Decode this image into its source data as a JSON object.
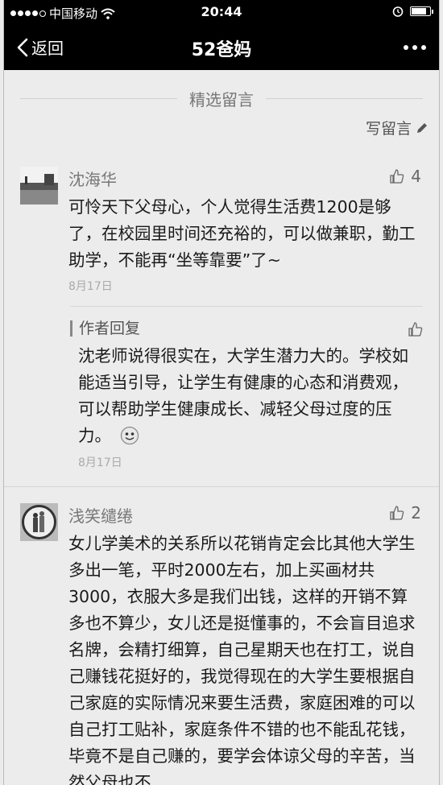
{
  "status_bar": {
    "carrier": "中国移动",
    "time": "20:44",
    "battery_level": 0.85
  },
  "nav": {
    "back_label": "返回",
    "title": "52爸妈"
  },
  "section": {
    "title": "精选留言",
    "write_label": "写留言"
  },
  "comments": [
    {
      "name": "沈海华",
      "likes": "4",
      "text": "可怜天下父母心，个人觉得生活费1200是够了，在校园里时间还充裕的，可以做兼职，勤工助学，不能再“坐等靠要”了~",
      "date": "8月17日",
      "reply": {
        "label": "作者回复",
        "text": "沈老师说得很实在，大学生潜力大的。学校如能适当引导，让学生有健康的心态和消费观，可以帮助学生健康成长、减轻父母过度的压力。",
        "date": "8月17日"
      }
    },
    {
      "name": "浅笑缱绻",
      "likes": "2",
      "text": "女儿学美术的关系所以花销肯定会比其他大学生多出一笔，平时2000左右，加上买画材共3000，衣服大多是我们出钱，这样的开销不算多也不算少，女儿还是挺懂事的，不会盲目追求名牌，会精打细算，自己星期天也在打工，说自己赚钱花挺好的，我觉得现在的大学生要根据自己家庭的实际情况来要生活费，家庭困难的可以自己打工贴补，家庭条件不错的也不能乱花钱，毕竟不是自己赚的，要学会体谅父母的辛苦，当然父母也不"
    }
  ],
  "icons": {
    "back": "chevron-left-icon",
    "more": "more-icon",
    "write": "pencil-icon",
    "like": "thumbs-up-icon",
    "smiley": "smiley-icon",
    "wifi": "wifi-icon",
    "alarm": "alarm-icon",
    "battery": "battery-icon"
  }
}
